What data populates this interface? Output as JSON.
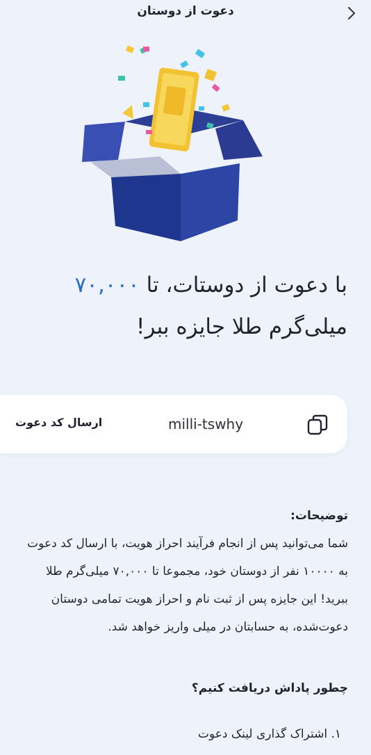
{
  "header": {
    "title": "دعوت از دوستان"
  },
  "headline": {
    "prefix": "با دعوت از دوستات، تا",
    "amount": "۷۰,۰۰۰",
    "suffix": "میلی‌گرم طلا جایزه ببر!"
  },
  "invite": {
    "send_label": "ارسال کد دعوت",
    "code": "milli-tswhy"
  },
  "description": {
    "title": "توضیحات:",
    "body": "شما می‌توانید پس از انجام فرآیند احراز هویت، با ارسال کد دعوت به ۱۰۰۰۰ نفر از دوستان خود، مجموعا تا ۷۰,۰۰۰ میلی‌گرم طلا ببرید! این جایزه پس از ثبت نام و احراز هویت تمامی دوستان دعوت‌شده، به حسابتان در میلی واریز خواهد شد."
  },
  "how": {
    "title": "چطور پاداش دریافت کنیم؟",
    "steps": [
      "۱. اشتراک گذاری لینک دعوت"
    ]
  },
  "colors": {
    "accent": "#2d6cc0",
    "background": "#eef3fb",
    "box_blue": "#223a9a",
    "gold": "#f2c232"
  }
}
